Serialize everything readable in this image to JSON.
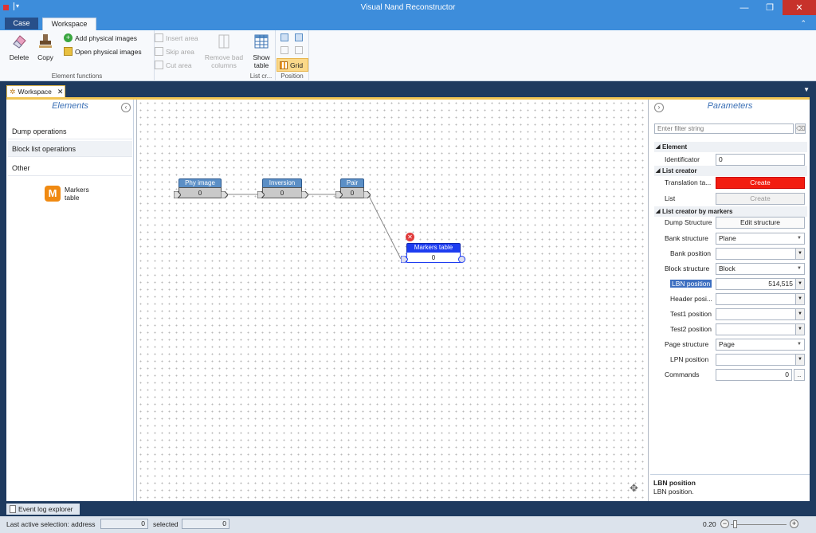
{
  "window": {
    "title": "Visual Nand Reconstructor"
  },
  "ribbon_tabs": {
    "case": "Case",
    "workspace": "Workspace"
  },
  "ribbon": {
    "delete": "Delete",
    "copy": "Copy",
    "add_physical_images": "Add physical images",
    "open_physical_images": "Open physical images",
    "insert_area": "Insert area",
    "skip_area": "Skip area",
    "cut_area": "Cut area",
    "remove_bad_columns_1": "Remove bad",
    "remove_bad_columns_2": "columns",
    "element_functions": "Element functions",
    "show_table_1": "Show",
    "show_table_2": "table",
    "list_creation": "List cr...",
    "grid": "Grid",
    "position": "Position"
  },
  "doc_tab": {
    "label": "Workspace"
  },
  "elements_panel": {
    "title": "Elements",
    "categories": [
      "Dump operations",
      "Block list operations",
      "Other"
    ],
    "item": {
      "icon_letter": "M",
      "line1": "Markers",
      "line2": "table"
    }
  },
  "canvas": {
    "nodes": [
      {
        "title": "Phy image",
        "value": "0"
      },
      {
        "title": "Inversion",
        "value": "0"
      },
      {
        "title": "Pair",
        "value": "0"
      },
      {
        "title": "Markers table",
        "value": "0"
      }
    ]
  },
  "parameters": {
    "title": "Parameters",
    "filter_placeholder": "Enter filter string",
    "sections": {
      "element": "Element",
      "list_creator": "List creator",
      "list_creator_by_markers": "List creator by markers"
    },
    "rows": {
      "identificator": {
        "name": "Identificator",
        "value": "0"
      },
      "translation_table": {
        "name": "Translation ta...",
        "value": "Create"
      },
      "list": {
        "name": "List",
        "value": "Create"
      },
      "dump_structure": {
        "name": "Dump Structure",
        "value": "Edit structure"
      },
      "bank_structure": {
        "name": "Bank structure",
        "value": "Plane"
      },
      "bank_position": {
        "name": "Bank position",
        "value": ""
      },
      "block_structure": {
        "name": "Block structure",
        "value": "Block"
      },
      "lbn_position": {
        "name": "LBN position",
        "value": "514,515"
      },
      "header_position": {
        "name": "Header posi...",
        "value": ""
      },
      "test1_position": {
        "name": "Test1 position",
        "value": ""
      },
      "test2_position": {
        "name": "Test2 position",
        "value": ""
      },
      "page_structure": {
        "name": "Page structure",
        "value": "Page"
      },
      "lpn_position": {
        "name": "LPN position",
        "value": ""
      },
      "commands": {
        "name": "Commands",
        "value": "0",
        "button": ".."
      }
    },
    "description": {
      "title": "LBN position",
      "text": "LBN position."
    }
  },
  "event_log": {
    "label": "Event log explorer"
  },
  "status": {
    "last_active": "Last active selection:  address",
    "address_value": "0",
    "selected_label": "selected",
    "selected_value": "0",
    "zoom": "0.20"
  }
}
